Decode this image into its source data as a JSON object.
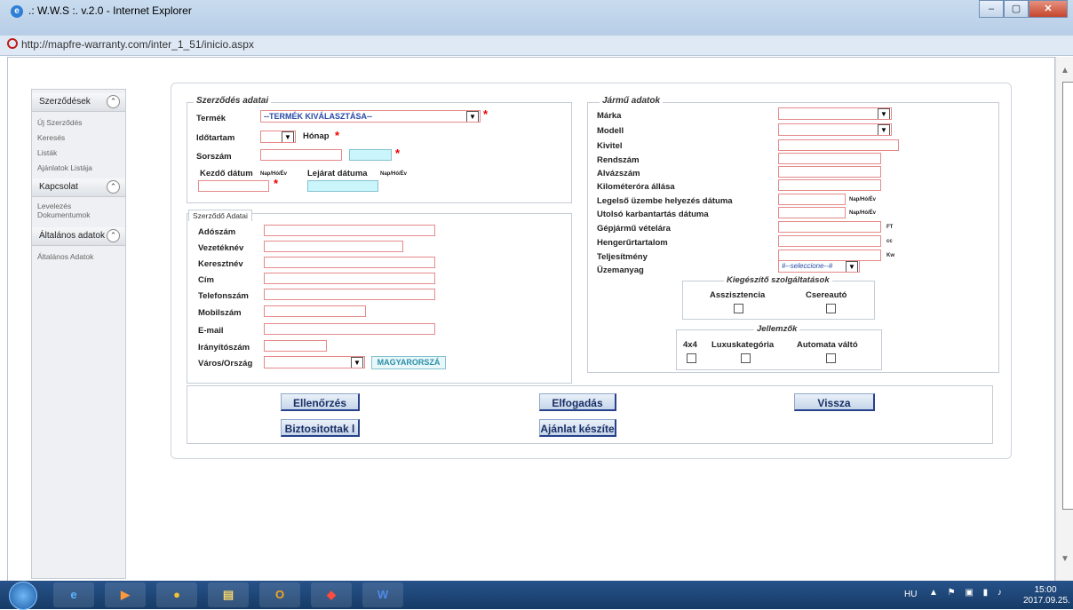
{
  "window": {
    "title": ".: W.W.S :. v.2.0 - Internet Explorer",
    "url": "http://mapfre-warranty.com/inter_1_51/inicio.aspx",
    "minimize": "‒",
    "maximize": "▢",
    "close": "✕"
  },
  "sidebar": {
    "sections": [
      {
        "title": "Szerződések",
        "items": [
          "Új Szerződés",
          "Keresés",
          "Listák",
          "Ajánlatok Listája"
        ]
      },
      {
        "title": "Kapcsolat",
        "items": [
          "Levelezés Dokumentumok"
        ]
      },
      {
        "title": "Általános adatok",
        "items": [
          "Általános Adatok"
        ]
      }
    ],
    "collapse_glyph": "⌃"
  },
  "contract": {
    "legend": "Szerződés adatai",
    "product_label": "Termék",
    "product_value": "--TERMÉK KIVÁLASZTÁSA--",
    "duration_label": "Időtartam",
    "duration_unit": "Hónap",
    "serial_label": "Sorszám",
    "start_label": "Kezdő dátum",
    "start_format": "Nap/Hó/Év",
    "end_label": "Lejárat dátuma",
    "end_format": "Nap/Hó/Év",
    "required": "*"
  },
  "contractor": {
    "tab": "Szerződő Adatai",
    "fields": [
      "Adószám",
      "Vezetéknév",
      "Keresztnév",
      "Cím",
      "Telefonszám",
      "Mobilszám",
      "E-mail",
      "Irányítószám",
      "Város/Ország"
    ],
    "country_value": "MAGYARORSZÁ"
  },
  "vehicle": {
    "legend": "Jármű adatok",
    "fields": [
      "Márka",
      "Modell",
      "Kivitel",
      "Rendszám",
      "Alvázszám",
      "Kilométeróra állása",
      "Legelső üzembe helyezés dátuma",
      "Utolsó karbantartás dátuma",
      "Gépjármű vételára",
      "Hengerűrtartalom",
      "Teljesítmény",
      "Üzemanyag"
    ],
    "date_format": "Nap/Hó/Év",
    "price_unit": "FT",
    "volume_unit": "cc",
    "power_unit": "Kw",
    "fuel_value": "#--seleccione--#"
  },
  "extras": {
    "legend": "Kiegészítő szolgáltatások",
    "options": [
      "Asszisztencia",
      "Csereautó"
    ]
  },
  "features": {
    "legend": "Jellemzők",
    "options": [
      "4x4",
      "Luxuskategória",
      "Automata váltó"
    ]
  },
  "buttons": {
    "check": "Ellenőrzés",
    "accept": "Elfogadás",
    "back": "Vissza",
    "insurers": "Biztositottak l",
    "quote": "Ajánlat készíte"
  },
  "taskbar": {
    "lang": "HU",
    "time": "15:00",
    "date": "2017.09.25."
  }
}
